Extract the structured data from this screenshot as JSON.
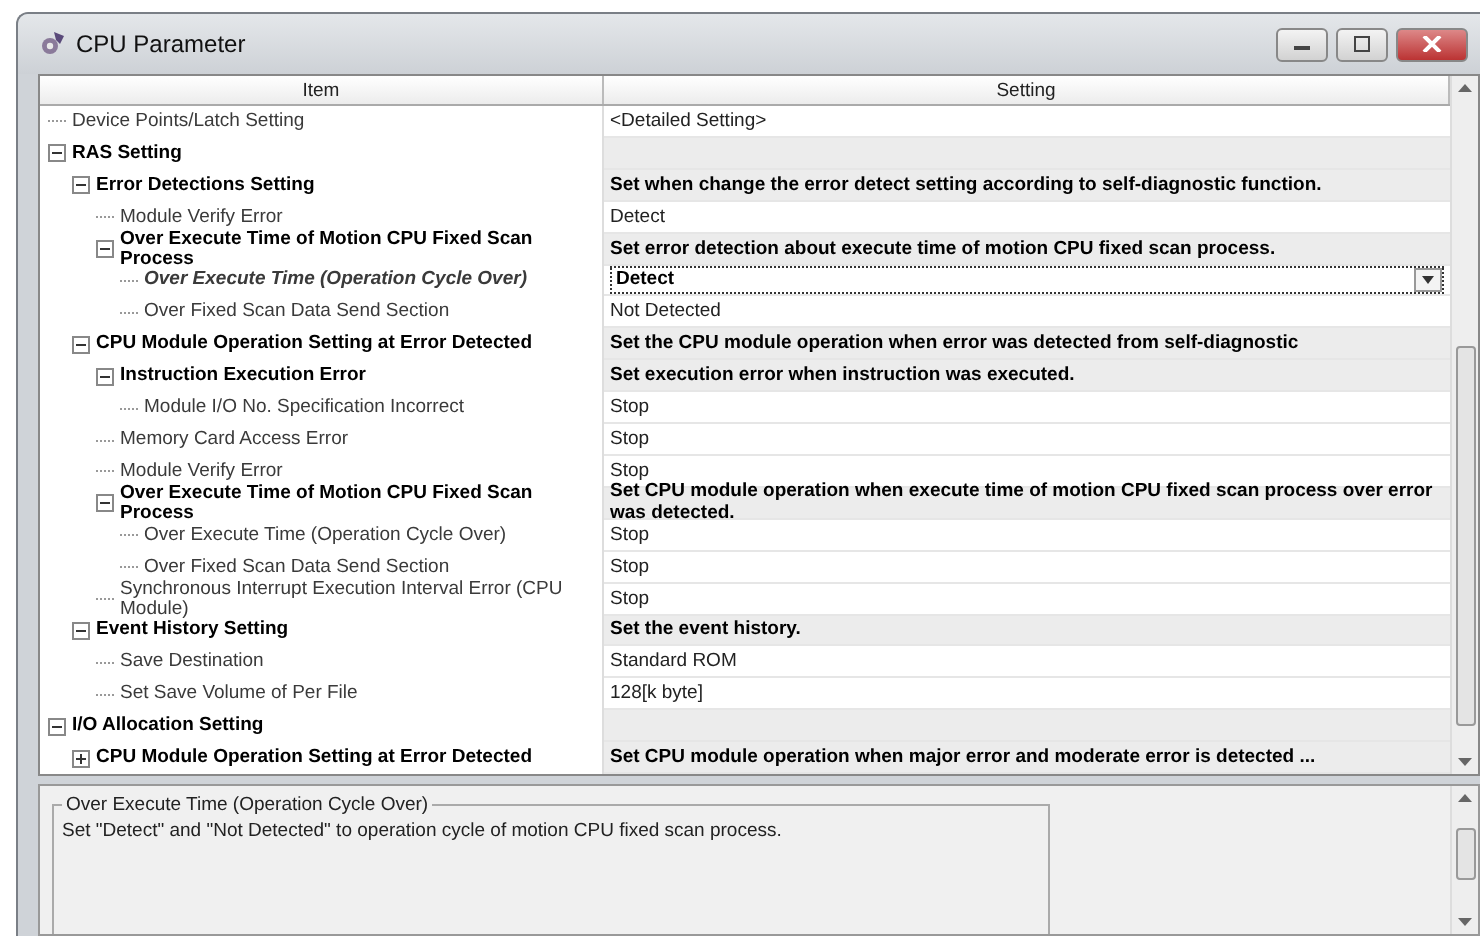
{
  "window": {
    "title": "CPU Parameter"
  },
  "table": {
    "columns": [
      "Item",
      "Setting"
    ],
    "rows": [
      {
        "kind": "item",
        "item": "Device Points/Latch Setting",
        "setting": "<Detailed Setting>",
        "selected": false
      },
      {
        "kind": "group",
        "item": "RAS Setting",
        "setting": "",
        "expanded": true,
        "selected": false,
        "children": [
          {
            "kind": "group",
            "item": "Error Detections Setting",
            "setting": "Set when change the error detect setting according to self-diagnostic function.",
            "expanded": true,
            "selected": false,
            "children": [
              {
                "kind": "item",
                "item": "Module Verify Error",
                "setting": "Detect",
                "selected": false
              },
              {
                "kind": "group",
                "item": "Over Execute Time of Motion CPU Fixed Scan Process",
                "setting": "Set error detection about execute time of motion CPU fixed scan process.",
                "expanded": true,
                "selected": false,
                "children": [
                  {
                    "kind": "item",
                    "item": "Over Execute Time (Operation Cycle Over)",
                    "setting": "Detect",
                    "selected": true
                  },
                  {
                    "kind": "item",
                    "item": "Over Fixed Scan Data Send Section",
                    "setting": "Not Detected",
                    "selected": false
                  }
                ]
              }
            ]
          },
          {
            "kind": "group",
            "item": "CPU Module Operation Setting at Error Detected",
            "setting": "Set the CPU module operation when error was detected from self-diagnostic",
            "expanded": true,
            "selected": false,
            "children": [
              {
                "kind": "group",
                "item": "Instruction Execution Error",
                "setting": "Set execution error when instruction was executed.",
                "expanded": true,
                "selected": false,
                "children": [
                  {
                    "kind": "item",
                    "item": "Module I/O No. Specification Incorrect",
                    "setting": "Stop",
                    "selected": false
                  }
                ]
              },
              {
                "kind": "item",
                "item": "Memory Card Access Error",
                "setting": "Stop",
                "selected": false
              },
              {
                "kind": "item",
                "item": "Module Verify Error",
                "setting": "Stop",
                "selected": false
              },
              {
                "kind": "group",
                "item": "Over Execute Time of Motion CPU Fixed Scan Process",
                "setting": "Set CPU module operation when execute time of motion CPU fixed scan process over error was detected.",
                "expanded": true,
                "selected": false,
                "children": [
                  {
                    "kind": "item",
                    "item": "Over Execute Time (Operation Cycle Over)",
                    "setting": "Stop",
                    "selected": false
                  },
                  {
                    "kind": "item",
                    "item": "Over Fixed Scan Data Send Section",
                    "setting": "Stop",
                    "selected": false
                  }
                ]
              },
              {
                "kind": "item",
                "item": "Synchronous Interrupt Execution Interval Error (CPU Module)",
                "setting": "Stop",
                "selected": false
              }
            ]
          },
          {
            "kind": "group",
            "item": "Event History Setting",
            "setting": "Set the event history.",
            "expanded": true,
            "selected": false,
            "children": [
              {
                "kind": "item",
                "item": "Save Destination",
                "setting": "Standard ROM",
                "selected": false
              },
              {
                "kind": "item",
                "item": "Set Save Volume of Per File",
                "setting": "128[k byte]",
                "selected": false
              }
            ]
          }
        ]
      },
      {
        "kind": "group",
        "item": "I/O Allocation Setting",
        "setting": "",
        "expanded": true,
        "selected": false,
        "children": [
          {
            "kind": "group",
            "item": "CPU Module Operation Setting at Error Detected",
            "setting": "Set CPU module operation when major error and moderate error is detected ...",
            "expanded": false,
            "selected": false
          }
        ]
      }
    ]
  },
  "description": {
    "title": "Over Execute Time (Operation Cycle Over)",
    "text": "Set \"Detect\" and \"Not Detected\"  to operation cycle of motion CPU fixed scan process."
  }
}
